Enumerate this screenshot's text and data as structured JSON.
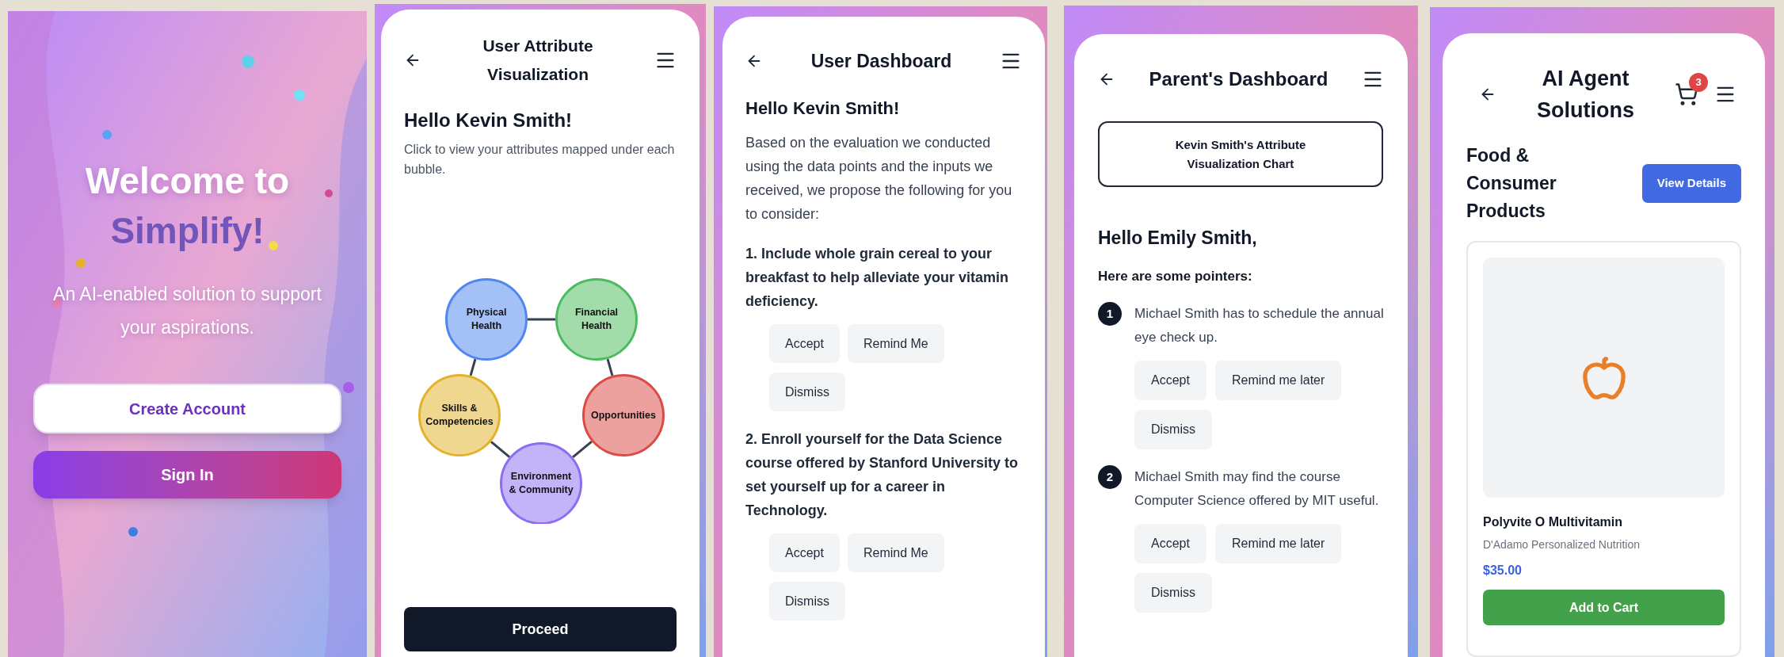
{
  "screens": [
    {
      "kind": "welcome",
      "title": "Welcome to",
      "brand": "Simplify!",
      "tagline": "An AI-enabled solution to support your aspirations.",
      "buttons": [
        {
          "label": "Create Account",
          "kind": "secondary"
        },
        {
          "label": "Sign In",
          "kind": "primary"
        }
      ]
    },
    {
      "kind": "attributes",
      "title": "User Attribute Visualization",
      "greeting": "Hello Kevin Smith!",
      "intro": "Click to view your attributes mapped under each bubble.",
      "bubbles": [
        {
          "label": "Physical Health",
          "color": "#4f86f0"
        },
        {
          "label": "Financial Health",
          "color": "#4cbb5e"
        },
        {
          "label": "Skills & Competencies",
          "color": "#e2b22a"
        },
        {
          "label": "Opportunities",
          "color": "#dc4a46"
        },
        {
          "label": "Environment & Community",
          "color": "#8b6cf2"
        }
      ],
      "button": "Proceed"
    },
    {
      "kind": "dashboard",
      "title": "User Dashboard",
      "greeting": "Hello Kevin Smith!",
      "intro": "Based on the evaluation we conducted using the data points and the inputs we received, we propose the following for you to consider:",
      "suggestions": [
        {
          "text": "1. Include whole grain cereal to your breakfast to help alleviate your vitamin deficiency.",
          "actions": [
            "Accept",
            "Remind Me",
            "Dismiss"
          ]
        },
        {
          "text": "2. Enroll yourself for the Data Science course offered by Stanford University to set yourself up for a career in Technology.",
          "actions": [
            "Accept",
            "Remind Me",
            "Dismiss"
          ]
        }
      ]
    },
    {
      "kind": "parent",
      "title": "Parent's Dashboard",
      "chart_button": "Kevin Smith's Attribute Visualization Chart",
      "greeting": "Hello Emily Smith,",
      "subheading": "Here are some pointers:",
      "pointers": [
        {
          "number": "1",
          "text": "Michael Smith has to schedule the annual eye check up.",
          "actions": [
            "Accept",
            "Remind me later",
            "Dismiss"
          ]
        },
        {
          "number": "2",
          "text": "Michael Smith may find the course Computer Science offered by MIT useful.",
          "actions": [
            "Accept",
            "Remind me later",
            "Dismiss"
          ]
        }
      ]
    },
    {
      "kind": "shop",
      "title": "AI Agent Solutions",
      "cart_count": "3",
      "category": "Food & Consumer Products",
      "details_button": "View Details",
      "product": {
        "name": "Polyvite O Multivitamin",
        "brand": "D'Adamo Personalized Nutrition",
        "price": "$35.00",
        "button": "Add to Cart"
      }
    }
  ]
}
